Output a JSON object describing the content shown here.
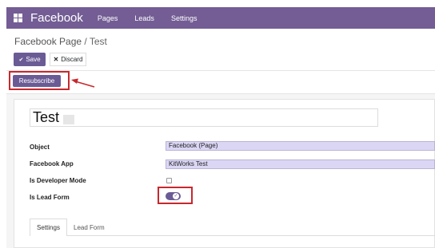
{
  "topbar": {
    "brand": "Facebook",
    "menu": [
      "Pages",
      "Leads",
      "Settings"
    ],
    "bg_color": "#735d94"
  },
  "breadcrumb": {
    "parent": "Facebook Page",
    "separator": "/",
    "current": "Test"
  },
  "actions": {
    "save_label": "Save",
    "discard_label": "Discard",
    "resubscribe_label": "Resubscribe"
  },
  "form": {
    "name": "Test",
    "fields": [
      {
        "label": "Object",
        "value": "Facebook (Page)"
      },
      {
        "label": "Facebook App",
        "value": "KitWorks Test"
      },
      {
        "label": "Is Developer Mode",
        "checked": false
      },
      {
        "label": "Is Lead Form",
        "toggle_on": true
      }
    ]
  },
  "tabs": [
    "Settings",
    "Lead Form"
  ],
  "colors": {
    "accent": "#6b5b95",
    "highlight": "#c8282d",
    "field_bg": "#dcd6f5"
  },
  "icons": {
    "apps": "apps-grid-icon",
    "discard": "close-icon",
    "toggle": "check-icon"
  }
}
